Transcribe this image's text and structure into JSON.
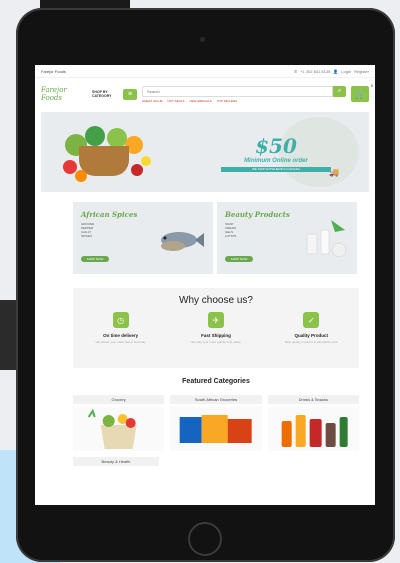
{
  "topbar": {
    "brand": "Farejor Foods",
    "phone": "+1 302 831 8139",
    "login": "Login",
    "register": "Register"
  },
  "header": {
    "logo_text": "Farejor Foods",
    "shop_by": "SHOP BY",
    "category": "CATEGORY",
    "search_placeholder": "Search",
    "quick_links": [
      "GREAT VALUE",
      "HOT DEALS",
      "NEW ARRIVALS",
      "TOP SELLERS"
    ],
    "cart_count": "0"
  },
  "hero": {
    "amount": "$50",
    "label": "Minimum Online order",
    "bar_text": "WE SHIP ANYWHERE IN CANADA"
  },
  "banners": [
    {
      "title": "African Spices",
      "items": [
        "GROUND",
        "PEPPER",
        "CHILLY",
        "SPICES"
      ],
      "button": "SHOP NOW"
    },
    {
      "title": "Beauty Products",
      "items": [
        "SOAP",
        "CREAM",
        "GELS",
        "LOTION"
      ],
      "button": "SHOP NOW"
    }
  ],
  "why": {
    "heading": "Why choose us?",
    "features": [
      {
        "title": "On time delivery",
        "desc": "We deliver your order fast to Gateway",
        "icon": "clock-icon"
      },
      {
        "title": "Fast Shipping",
        "desc": "We ship your order quickly and safely",
        "icon": "plane-icon"
      },
      {
        "title": "Quality Product",
        "desc": "Best quality products at affordable price",
        "icon": "check-icon"
      }
    ]
  },
  "featured": {
    "heading": "Featured Categories",
    "categories": [
      "Grocery",
      "South African Groceries",
      "Drinks & Snacks",
      "Beauty & Health"
    ]
  },
  "colors": {
    "accent": "#8bc34a",
    "teal": "#3fb0a9",
    "brand_green": "#6aa84f"
  }
}
